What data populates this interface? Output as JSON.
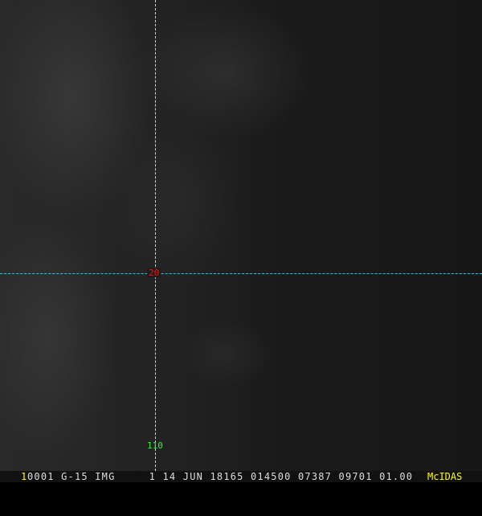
{
  "overlay": {
    "latitude_label": "20",
    "longitude_label": "110",
    "line_color": "#00d8e8"
  },
  "status_bar": {
    "frame_number": "1",
    "info": "0001 G-15 IMG     1 14 JUN 18165 014500 07387 09701 01.00",
    "logo": "McIDAS"
  }
}
